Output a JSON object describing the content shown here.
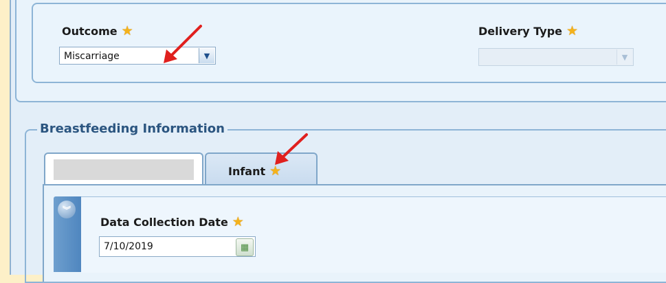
{
  "outcome": {
    "label": "Outcome",
    "value": "Miscarriage",
    "required_icon": "star-icon"
  },
  "delivery_type": {
    "label": "Delivery Type",
    "value": "",
    "disabled": true,
    "required_icon": "star-icon"
  },
  "breastfeeding": {
    "title": "Breastfeeding Information",
    "tabs": [
      {
        "label": ""
      },
      {
        "label": "Infant"
      }
    ],
    "data_collection": {
      "label": "Data Collection Date",
      "value": "7/10/2019",
      "required_icon": "star-icon"
    }
  },
  "colors": {
    "background": "#fdf0c8",
    "panel": "#e9f3fb",
    "border": "#8db4d6",
    "section_title": "#2b5580",
    "required_star": "#f4b21b",
    "annotation_arrow": "#e0201e"
  }
}
